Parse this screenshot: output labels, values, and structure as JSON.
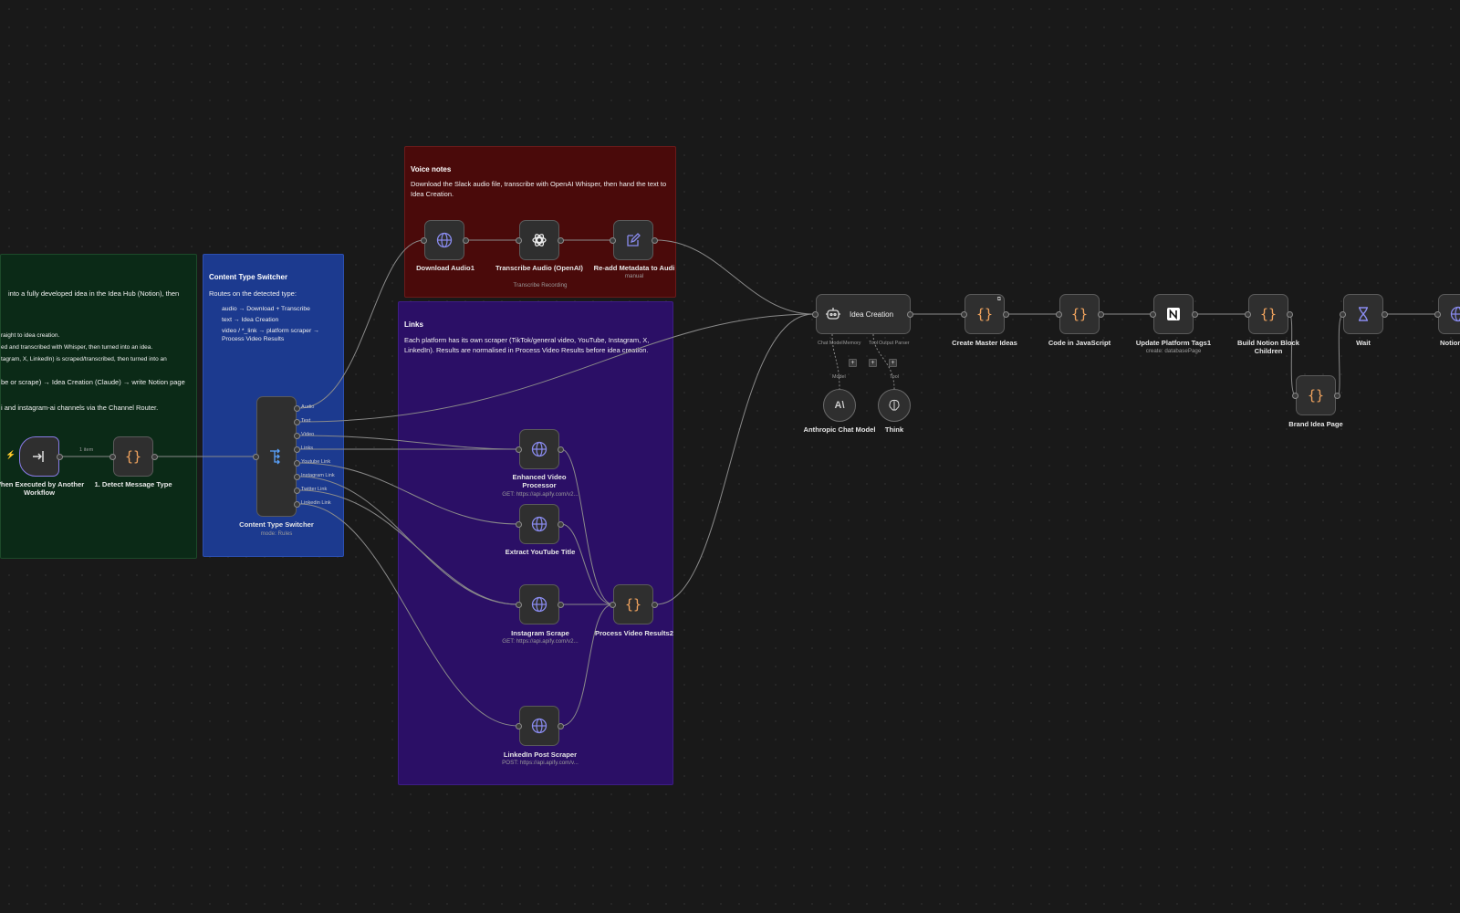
{
  "stickies": {
    "green": {
      "line1": "into a fully developed idea in the Idea Hub (Notion), then",
      "line2": "raight to idea creation.",
      "line3": "ed and transcribed with Whisper, then turned into an idea.",
      "line4": "tagram, X, LinkedIn) is scraped/transcribed, then turned into an",
      "line5": "be or scrape) → Idea Creation (Claude) → write Notion page",
      "line6": "i and instagram-ai channels via the Channel Router."
    },
    "blue": {
      "title": "Content Type Switcher",
      "intro": "Routes on the detected type:",
      "items": [
        "audio → Download + Transcribe",
        "text → Idea Creation",
        "video / *_link → platform scraper → Process Video Results"
      ]
    },
    "red": {
      "title": "Voice notes",
      "text": "Download the Slack audio file, transcribe with OpenAI Whisper, then hand the text to Idea Creation."
    },
    "purple": {
      "title": "Links",
      "text": "Each platform has its own scraper (TikTok/general video, YouTube, Instagram, X, LinkedIn). Results are normalised in Process Video Results before idea creation."
    }
  },
  "nodes": {
    "trigger": {
      "label": "When Executed by Another Workflow"
    },
    "detect": {
      "label": "1. Detect Message Type"
    },
    "edge_label_items": "1 item",
    "switcher": {
      "label": "Content Type Switcher",
      "sub": "mode: Rules",
      "outputs": [
        "Audio",
        "Text",
        "Video",
        "Links",
        "Youtube Link",
        "Instagram Link",
        "Twitter Link",
        "Linkedin Link"
      ]
    },
    "download_audio": {
      "label": "Download Audio1"
    },
    "transcribe": {
      "label": "Transcribe Audio (OpenAI)",
      "sub": "Transcribe Recording"
    },
    "readd_meta": {
      "label": "Re-add Metadata to Audi",
      "sub": "manual"
    },
    "enhanced_video": {
      "label": "Enhanced Video Processor",
      "sub": "GET: https://api.apify.com/v2..."
    },
    "youtube_title": {
      "label": "Extract YouTube Title"
    },
    "instagram": {
      "label": "Instagram Scrape",
      "sub": "GET: https://api.apify.com/v2..."
    },
    "linkedin": {
      "label": "LinkedIn Post Scraper",
      "sub": "POST: https://api.apify.com/v..."
    },
    "process_video": {
      "label": "Process Video Results2"
    },
    "idea_creation": {
      "label": "Idea Creation",
      "ports": [
        "Chat Model",
        "Memory",
        "Tool",
        "Output Parser"
      ],
      "model_label": "Model",
      "tool_label": "Tool"
    },
    "anthropic": {
      "label": "Anthropic Chat Model"
    },
    "think": {
      "label": "Think"
    },
    "create_master": {
      "label": "Create Master Ideas"
    },
    "code_js": {
      "label": "Code in JavaScript"
    },
    "update_tags": {
      "label": "Update Platform Tags1",
      "sub": "create: databasePage"
    },
    "build_notion": {
      "label": "Build Notion Block Children"
    },
    "brand_idea": {
      "label": "Brand Idea Page"
    },
    "wait": {
      "label": "Wait"
    },
    "notion_partial": {
      "label": "Notion"
    }
  },
  "colors": {
    "canvas": "#191919",
    "sticky_green": "#0b2a17",
    "sticky_blue": "#1c3a8f",
    "sticky_red": "#4a0a0a",
    "sticky_purple": "#2b0f66",
    "code_icon": "#f0a35e",
    "http_icon": "#8a8cf0"
  },
  "icons": {
    "trigger": "arrow-into-box-icon",
    "code": "curly-braces-icon",
    "switch": "branch-switch-icon",
    "http": "globe-icon",
    "openai": "openai-icon",
    "edit": "pencil-icon",
    "agent": "robot-icon",
    "notion": "notion-icon",
    "wait": "hourglass-icon",
    "anthropic": "anthropic-icon",
    "think": "brain-icon"
  }
}
